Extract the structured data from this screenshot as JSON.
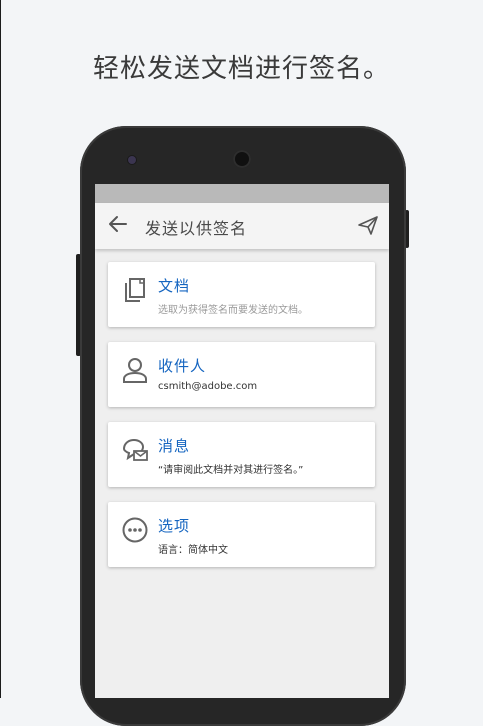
{
  "headline": "轻松发送文档进行签名。",
  "app": {
    "title": "发送以供签名"
  },
  "cards": [
    {
      "title": "文档",
      "subtitle": "选取为获得签名而要发送的文档。",
      "icon": "document-icon"
    },
    {
      "title": "收件人",
      "subtitle": "csmith@adobe.com",
      "icon": "person-icon"
    },
    {
      "title": "消息",
      "subtitle": "“请审阅此文档并对其进行签名。”",
      "icon": "message-icon"
    },
    {
      "title": "选项",
      "subtitle": "语言：简体中文",
      "icon": "more-options-icon"
    }
  ],
  "colors": {
    "accent": "#1565c0",
    "background": "#f3f5f7",
    "phone": "#262626",
    "screen": "#efefef"
  }
}
